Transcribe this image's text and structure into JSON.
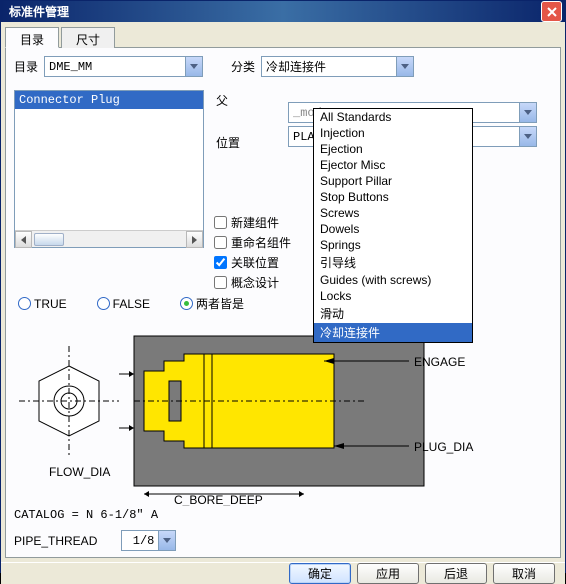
{
  "window": {
    "title": "标准件管理"
  },
  "tabs": {
    "items": [
      "目录",
      "尺寸"
    ],
    "active": 0
  },
  "row1": {
    "catalog_label": "目录",
    "catalog_value": "DME_MM",
    "category_label": "分类",
    "category_value": "冷却连接件"
  },
  "listbox": {
    "items": [
      "Connector Plug"
    ]
  },
  "mid": {
    "parent_label": "父",
    "parent_value": "_mode",
    "position_label": "位置",
    "position_value": "PLANE"
  },
  "checks": {
    "new_component": {
      "label": "新建组件",
      "checked": false
    },
    "rename_component": {
      "label": "重命名组件",
      "checked": false
    },
    "link_position": {
      "label": "关联位置",
      "checked": true
    },
    "concept_design": {
      "label": "概念设计",
      "checked": false
    }
  },
  "dropdown_options": [
    "All Standards",
    "Injection",
    "Ejection",
    "Ejector Misc",
    "Support Pillar",
    "Stop Buttons",
    "Screws",
    "Dowels",
    "Springs",
    "引导线",
    "Guides (with screws)",
    "Locks",
    "滑动",
    "冷却连接件"
  ],
  "dropdown_selected": "冷却连接件",
  "radios": {
    "options": [
      {
        "label": "TRUE",
        "checked": false
      },
      {
        "label": "FALSE",
        "checked": false
      },
      {
        "label": "两者皆是",
        "checked": true
      }
    ]
  },
  "diagram": {
    "labels": {
      "engage": "ENGAGE",
      "plug_dia": "PLUG_DIA",
      "flow_dia": "FLOW_DIA",
      "c_bore_deep": "C_BORE_DEEP"
    }
  },
  "catalog_text": "CATALOG = N 6-1/8\" A",
  "pipe": {
    "label": "PIPE_THREAD",
    "value": "1/8"
  },
  "footer": {
    "ok": "确定",
    "apply": "应用",
    "back": "后退",
    "cancel": "取消"
  }
}
